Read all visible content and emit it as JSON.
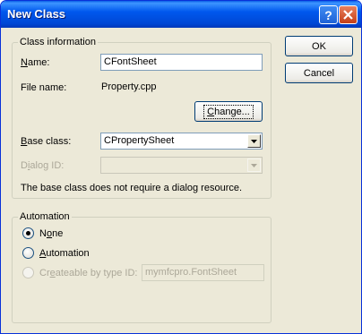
{
  "window": {
    "title": "New Class",
    "help_button": "?",
    "close_button": "×"
  },
  "class_info": {
    "group_label": "Class information",
    "name_label_accel": "N",
    "name_label_rest": "ame:",
    "name_value": "CFontSheet",
    "file_name_label": "File name:",
    "file_name_value": "Property.cpp",
    "change_button_accel": "C",
    "change_button_rest": "hange...",
    "base_class_label_accel": "B",
    "base_class_label_rest": "ase class:",
    "base_class_value": "CPropertySheet",
    "dialog_id_label_pre": "D",
    "dialog_id_label_accel": "i",
    "dialog_id_label_rest": "alog ID:",
    "dialog_id_value": "",
    "note": "The base class does not require a dialog resource."
  },
  "automation": {
    "group_label": "Automation",
    "options": [
      {
        "accel": "o",
        "pre": "N",
        "rest": "ne",
        "checked": true,
        "enabled": true
      },
      {
        "accel": "A",
        "pre": "",
        "rest": "utomation",
        "checked": false,
        "enabled": true
      },
      {
        "accel": "e",
        "pre": "Cr",
        "rest": "ateable by type ID:",
        "checked": false,
        "enabled": false
      }
    ],
    "type_id_value": "mymfcpro.FontSheet"
  },
  "buttons": {
    "ok": "OK",
    "cancel": "Cancel"
  },
  "colors": {
    "titlebar": "#0058ee",
    "dialog_bg": "#ece9d8",
    "disabled_text": "#aca899",
    "radio_checked": "#21a121"
  }
}
